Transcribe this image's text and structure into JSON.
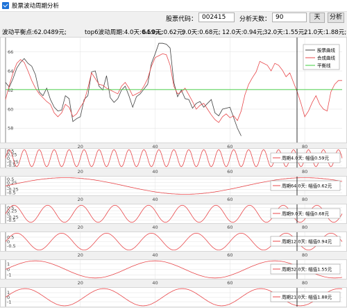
{
  "window": {
    "title": "股票波动周期分析"
  },
  "toolbar": {
    "code_label": "股票代码：",
    "code_value": "002415",
    "days_label": "分析天数：",
    "days_value": "90",
    "days_unit": "天",
    "analyze_label": "分析"
  },
  "summary": {
    "balance": "波动平衡点:62.0489元;",
    "top6": "top6波动周期:4.0天:0.59元;",
    "p1": "64.0天:0.62元;",
    "p2": "9.0天:0.68元;",
    "p3": "12.0天:0.94元;",
    "p4": "32.0天:1.55元;",
    "p5": "21.0天:1.88元;"
  },
  "colors": {
    "stock": "#404040",
    "synth": "#e8474a",
    "balance": "#3ecf3e",
    "cursor": "#000000",
    "grid": "#e6e6e6"
  },
  "chart_data": [
    {
      "type": "line",
      "legend_position": "top-right",
      "x_ticks": [
        "20",
        "40",
        "60",
        "80"
      ],
      "y_ticks": [
        "58",
        "60",
        "62",
        "64",
        "66"
      ],
      "xlim": [
        0,
        90
      ],
      "ylim": [
        56.5,
        67.5
      ],
      "series": [
        {
          "name": "股票曲线",
          "color": "#404040",
          "points": [
            [
              0,
              62.8
            ],
            [
              1,
              62.3
            ],
            [
              2,
              63.2
            ],
            [
              3,
              64.3
            ],
            [
              4,
              64.9
            ],
            [
              5,
              65.3
            ],
            [
              6,
              64.8
            ],
            [
              7,
              64.5
            ],
            [
              8,
              63.6
            ],
            [
              9,
              61.8
            ],
            [
              10,
              61.4
            ],
            [
              11,
              62.2
            ],
            [
              12,
              61.0
            ],
            [
              13,
              60.2
            ],
            [
              14,
              59.8
            ],
            [
              15,
              59.9
            ],
            [
              16,
              61.4
            ],
            [
              17,
              61.1
            ],
            [
              18,
              58.7
            ],
            [
              19,
              59.0
            ],
            [
              20,
              59.2
            ],
            [
              21,
              61.0
            ],
            [
              22,
              61.4
            ],
            [
              23,
              63.9
            ],
            [
              24,
              64.0
            ],
            [
              25,
              62.4
            ],
            [
              26,
              62.0
            ],
            [
              27,
              63.5
            ],
            [
              28,
              61.2
            ],
            [
              29,
              60.7
            ],
            [
              30,
              61.1
            ],
            [
              31,
              62.0
            ],
            [
              32,
              62.4
            ],
            [
              33,
              61.4
            ],
            [
              34,
              60.2
            ],
            [
              35,
              61.3
            ],
            [
              36,
              61.6
            ],
            [
              37,
              62.1
            ],
            [
              38,
              62.6
            ],
            [
              39,
              64.8
            ],
            [
              40,
              65.8
            ],
            [
              41,
              66.9
            ],
            [
              42,
              66.9
            ],
            [
              43,
              66.8
            ],
            [
              44,
              66.4
            ],
            [
              45,
              62.8
            ],
            [
              46,
              61.3
            ],
            [
              47,
              62.0
            ],
            [
              48,
              61.1
            ],
            [
              49,
              61.0
            ],
            [
              50,
              60.1
            ],
            [
              51,
              60.6
            ],
            [
              52,
              60.8
            ],
            [
              53,
              60.2
            ],
            [
              54,
              60.6
            ],
            [
              55,
              61.0
            ],
            [
              56,
              59.6
            ],
            [
              57,
              59.3
            ],
            [
              58,
              60.0
            ],
            [
              59,
              60.1
            ],
            [
              60,
              60.2
            ],
            [
              61,
              59.1
            ],
            [
              62,
              58.0
            ],
            [
              63,
              57.2
            ]
          ]
        },
        {
          "name": "合成曲线",
          "color": "#e8474a",
          "points": [
            [
              0,
              61.0
            ],
            [
              1,
              62.5
            ],
            [
              2,
              63.8
            ],
            [
              3,
              64.8
            ],
            [
              4,
              65.2
            ],
            [
              5,
              64.9
            ],
            [
              6,
              64.0
            ],
            [
              7,
              63.0
            ],
            [
              8,
              62.2
            ],
            [
              9,
              61.6
            ],
            [
              10,
              61.2
            ],
            [
              11,
              60.8
            ],
            [
              12,
              60.5
            ],
            [
              13,
              59.6
            ],
            [
              14,
              59.2
            ],
            [
              15,
              59.6
            ],
            [
              16,
              60.5
            ],
            [
              17,
              60.2
            ],
            [
              18,
              59.2
            ],
            [
              19,
              59.5
            ],
            [
              20,
              60.2
            ],
            [
              21,
              60.8
            ],
            [
              22,
              62.2
            ],
            [
              23,
              63.8
            ],
            [
              24,
              63.2
            ],
            [
              25,
              62.6
            ],
            [
              26,
              62.5
            ],
            [
              27,
              62.2
            ],
            [
              28,
              62.0
            ],
            [
              29,
              61.8
            ],
            [
              30,
              61.6
            ],
            [
              31,
              62.4
            ],
            [
              32,
              62.8
            ],
            [
              33,
              62.2
            ],
            [
              34,
              61.4
            ],
            [
              35,
              61.6
            ],
            [
              36,
              61.8
            ],
            [
              37,
              62.4
            ],
            [
              38,
              63.2
            ],
            [
              39,
              64.5
            ],
            [
              40,
              65.4
            ],
            [
              41,
              65.6
            ],
            [
              42,
              65.8
            ],
            [
              43,
              65.7
            ],
            [
              44,
              64.6
            ],
            [
              45,
              62.4
            ],
            [
              46,
              61.6
            ],
            [
              47,
              61.8
            ],
            [
              48,
              62.2
            ],
            [
              49,
              61.5
            ],
            [
              50,
              60.8
            ],
            [
              51,
              60.0
            ],
            [
              52,
              60.4
            ],
            [
              53,
              60.6
            ],
            [
              54,
              60.0
            ],
            [
              55,
              59.4
            ],
            [
              56,
              58.9
            ],
            [
              57,
              58.6
            ],
            [
              58,
              59.2
            ],
            [
              59,
              59.5
            ],
            [
              60,
              59.1
            ],
            [
              61,
              59.3
            ],
            [
              62,
              58.8
            ],
            [
              63,
              59.8
            ],
            [
              64,
              61.5
            ],
            [
              65,
              62.6
            ],
            [
              66,
              63.3
            ],
            [
              67,
              63.9
            ],
            [
              68,
              65.0
            ],
            [
              69,
              64.8
            ],
            [
              70,
              64.6
            ],
            [
              71,
              64.0
            ],
            [
              72,
              64.8
            ],
            [
              73,
              64.6
            ],
            [
              74,
              64.1
            ],
            [
              75,
              63.4
            ],
            [
              76,
              63.8
            ],
            [
              77,
              62.8
            ],
            [
              78,
              61.8
            ],
            [
              79,
              60.6
            ],
            [
              80,
              59.2
            ],
            [
              81,
              59.8
            ],
            [
              82,
              60.7
            ],
            [
              83,
              61.4
            ],
            [
              84,
              60.5
            ],
            [
              85,
              60.0
            ],
            [
              86,
              59.8
            ],
            [
              87,
              61.8
            ],
            [
              88,
              62.6
            ],
            [
              89,
              63.0
            ],
            [
              90,
              63.0
            ]
          ]
        },
        {
          "name": "平衡线",
          "color": "#3ecf3e",
          "points": [
            [
              0,
              62.0489
            ],
            [
              90,
              62.0489
            ]
          ]
        }
      ]
    },
    {
      "type": "line",
      "legend_label": "周期4.0天: 幅值0.59元",
      "period": 4.0,
      "amplitude": 0.59,
      "y_ticks": [
        "0.5",
        "0.25",
        "0",
        "-0.25",
        "-0.5"
      ],
      "ylim": [
        -0.65,
        0.65
      ],
      "x_ticks": [
        "20",
        "40",
        "60",
        "80"
      ]
    },
    {
      "type": "line",
      "legend_label": "周期64.0天: 幅值0.62元",
      "period": 64.0,
      "amplitude": 0.62,
      "y_ticks": [
        "0.5",
        "0.25",
        "0",
        "-0.25",
        "-0.5"
      ],
      "ylim": [
        -0.7,
        0.7
      ],
      "x_ticks": [
        "20",
        "40",
        "60",
        "80"
      ]
    },
    {
      "type": "line",
      "legend_label": "周期9.0天: 幅值0.68元",
      "period": 9.0,
      "amplitude": 0.68,
      "y_ticks": [
        "0.5",
        "0.25",
        "0",
        "-0.25",
        "-0.5"
      ],
      "ylim": [
        -0.75,
        0.75
      ],
      "x_ticks": [
        "20",
        "40",
        "60",
        "80"
      ]
    },
    {
      "type": "line",
      "legend_label": "周期12.0天: 幅值0.94元",
      "period": 12.0,
      "amplitude": 0.94,
      "y_ticks": [
        "0.5",
        "0",
        "-0.5"
      ],
      "ylim": [
        -1.05,
        1.05
      ],
      "x_ticks": [
        "20",
        "40",
        "60",
        "80"
      ]
    },
    {
      "type": "line",
      "legend_label": "周期32.0天: 幅值1.55元",
      "period": 32.0,
      "amplitude": 1.55,
      "y_ticks": [
        "1",
        "0",
        "-1"
      ],
      "ylim": [
        -1.7,
        1.7
      ],
      "x_ticks": [
        "20",
        "40",
        "60",
        "80"
      ]
    },
    {
      "type": "line",
      "legend_label": "周期21.0天: 幅值1.88元",
      "period": 21.0,
      "amplitude": 1.88,
      "y_ticks": [
        "1",
        "0",
        "-1"
      ],
      "ylim": [
        -2.05,
        2.05
      ],
      "x_ticks": [
        "20",
        "40",
        "60",
        "80"
      ]
    }
  ]
}
